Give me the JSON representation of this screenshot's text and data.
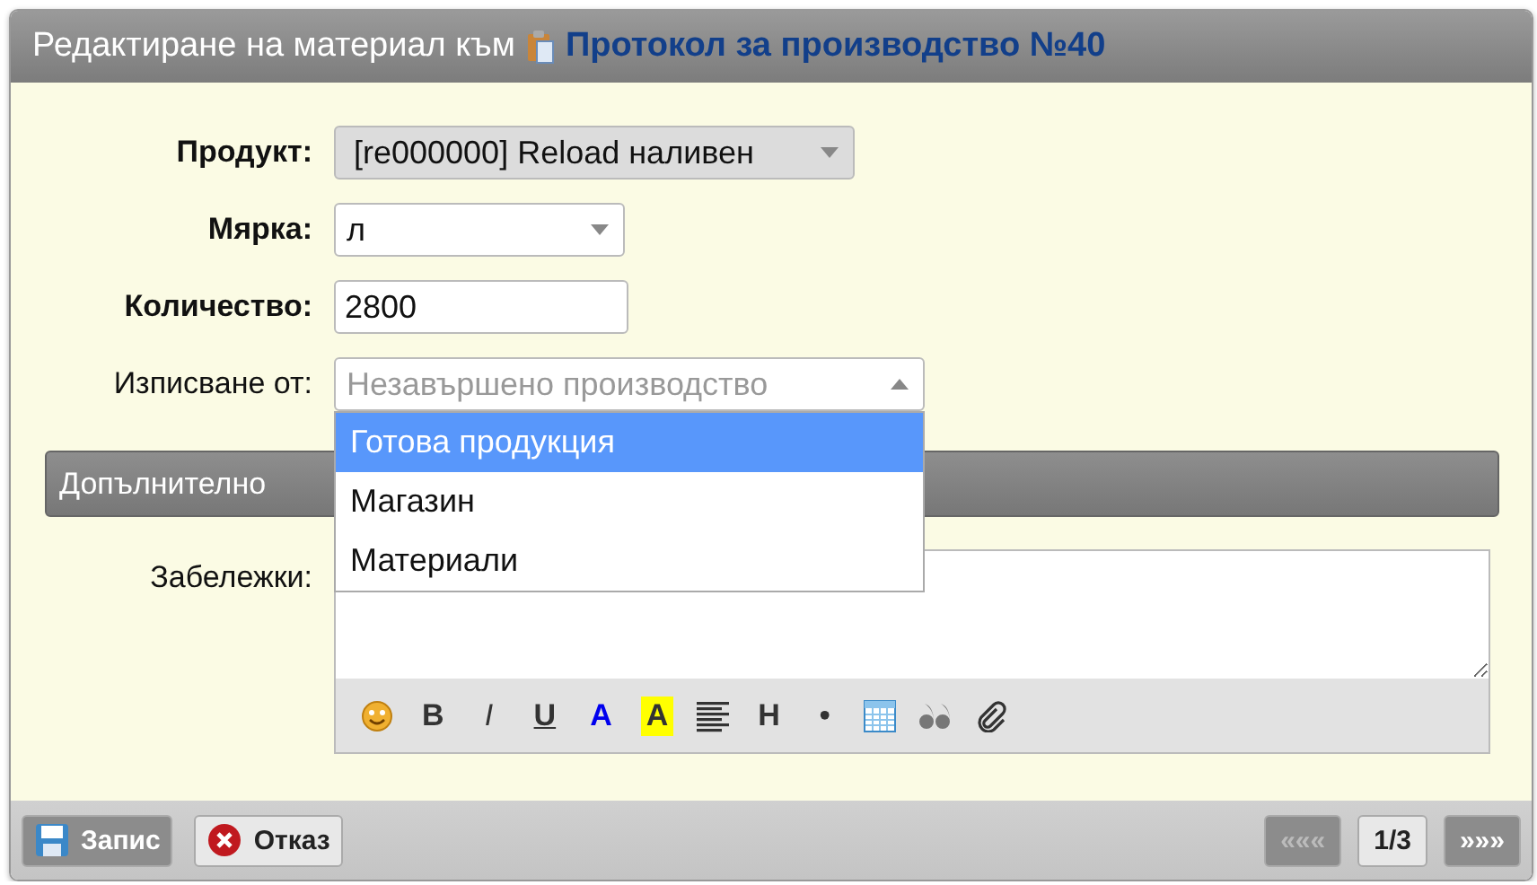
{
  "window": {
    "title": "Редактиране на материал към",
    "link": "Протокол за производство №40"
  },
  "fields": [
    {
      "kind": "select",
      "label": "Продукт:",
      "required": true,
      "readonly": true,
      "value": "[re000000] Reload наливен"
    },
    {
      "kind": "select",
      "label": "Мярка:",
      "required": true,
      "readonly": false,
      "value": "л"
    },
    {
      "kind": "input",
      "label": "Количество:",
      "required": true,
      "value": "2800"
    },
    {
      "kind": "combo",
      "label": "Изписване от:",
      "required": false,
      "placeholder": "Незавършено производство",
      "expanded": true,
      "options": [
        {
          "label": "Готова продукция",
          "selected": true
        },
        {
          "label": "Магазин",
          "selected": false
        },
        {
          "label": "Материали",
          "selected": false
        }
      ]
    }
  ],
  "section": {
    "title": "Допълнително"
  },
  "remarks": {
    "label": "Забележки:",
    "toolbar": [
      {
        "kind": "icon"
      },
      {
        "kind": "text",
        "text": "B"
      },
      {
        "kind": "text",
        "text": "I"
      },
      {
        "kind": "text",
        "text": "U"
      },
      {
        "kind": "text",
        "text": "A"
      },
      {
        "kind": "text",
        "text": "A"
      },
      {
        "kind": "icon"
      },
      {
        "kind": "text",
        "text": "H"
      },
      {
        "kind": "text",
        "text": "•"
      },
      {
        "kind": "icon"
      },
      {
        "kind": "icon"
      },
      {
        "kind": "icon"
      }
    ]
  },
  "footer": {
    "buttons": [
      {
        "label": "Запис",
        "kind": "save",
        "primary": true
      },
      {
        "label": "Отказ",
        "kind": "cancel",
        "primary": false
      }
    ],
    "pager": [
      {
        "label": "«««",
        "kind": "nav",
        "disabled": true
      },
      {
        "label": "1/3",
        "kind": "page"
      },
      {
        "label": "»»»",
        "kind": "nav",
        "disabled": false
      }
    ]
  }
}
